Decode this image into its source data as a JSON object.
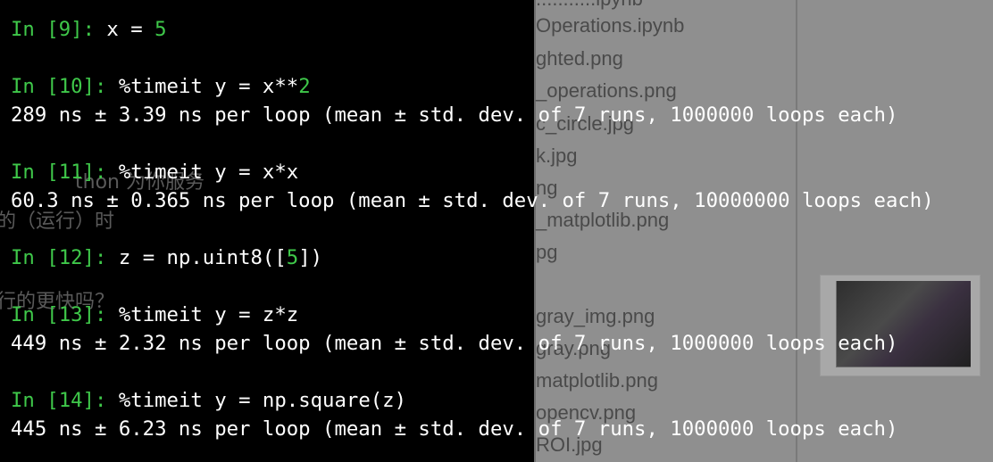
{
  "background_window": {
    "file_list": [
      "...........ipynb",
      "Operations.ipynb",
      "ghted.png",
      "_operations.png",
      "c_circle.jpg",
      "k.jpg",
      "ng",
      "_matplotlib.png",
      "pg",
      "gray_img.png",
      "gray.png",
      "matplotlib.png",
      "opencv.png",
      "ROI.jpg"
    ],
    "partial_text": [
      "thon 为你服务",
      "的（运行）时",
      "行的更快吗？"
    ]
  },
  "terminal": {
    "cells": [
      {
        "prompt_label": "In ",
        "prompt_num": "[9]",
        "prompt_colon": ": ",
        "code_pre": "x = ",
        "code_num": "5",
        "code_post": "",
        "output": ""
      },
      {
        "prompt_label": "In ",
        "prompt_num": "[10]",
        "prompt_colon": ": ",
        "code_pre": "%timeit y = x**",
        "code_num": "2",
        "code_post": "",
        "output": "289 ns ± 3.39 ns per loop (mean ± std. dev. of 7 runs, 1000000 loops each)"
      },
      {
        "prompt_label": "In ",
        "prompt_num": "[11]",
        "prompt_colon": ": ",
        "code_pre": "%timeit y = x*x",
        "code_num": "",
        "code_post": "",
        "output": "60.3 ns ± 0.365 ns per loop (mean ± std. dev. of 7 runs, 10000000 loops each)"
      },
      {
        "prompt_label": "In ",
        "prompt_num": "[12]",
        "prompt_colon": ": ",
        "code_pre": "z = np.uint8([",
        "code_num": "5",
        "code_post": "])",
        "output": ""
      },
      {
        "prompt_label": "In ",
        "prompt_num": "[13]",
        "prompt_colon": ": ",
        "code_pre": "%timeit y = z*z",
        "code_num": "",
        "code_post": "",
        "output": "449 ns ± 2.32 ns per loop (mean ± std. dev. of 7 runs, 1000000 loops each)"
      },
      {
        "prompt_label": "In ",
        "prompt_num": "[14]",
        "prompt_colon": ": ",
        "code_pre": "%timeit y = np.square(z)",
        "code_num": "",
        "code_post": "",
        "output": "445 ns ± 6.23 ns per loop (mean ± std. dev. of 7 runs, 1000000 loops each)"
      }
    ],
    "colors": {
      "prompt": "#3fc84a",
      "number_literal": "#3fc84a",
      "text": "#ffffff",
      "background": "#000000"
    }
  }
}
